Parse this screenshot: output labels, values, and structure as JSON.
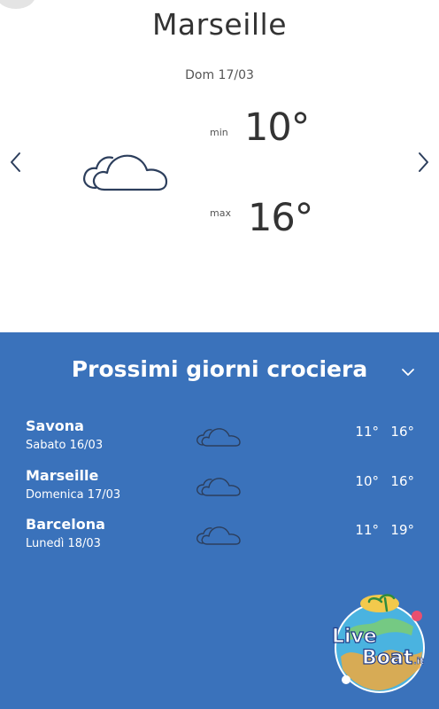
{
  "location": {
    "city": "Marseille",
    "date": "Dom 17/03"
  },
  "today": {
    "icon": "cloud-icon",
    "min_label": "min",
    "min_value": "10°",
    "max_label": "max",
    "max_value": "16°"
  },
  "nav": {
    "prev_icon": "chevron-left-icon",
    "next_icon": "chevron-right-icon"
  },
  "forecast": {
    "title": "Prossimi giorni crociera",
    "toggle_icon": "chevron-down-icon",
    "days": [
      {
        "port": "Savona",
        "day": "Sabato 16/03",
        "icon": "cloud-icon",
        "min": "11°",
        "max": "16°"
      },
      {
        "port": "Marseille",
        "day": "Domenica 17/03",
        "icon": "cloud-icon",
        "min": "10°",
        "max": "16°"
      },
      {
        "port": "Barcelona",
        "day": "Lunedì 18/03",
        "icon": "cloud-icon",
        "min": "11°",
        "max": "19°"
      }
    ]
  },
  "watermark": {
    "text": "LiveBoat.it"
  },
  "colors": {
    "panel_background": "#3a72bb",
    "icon_stroke": "#2c3e5c",
    "panel_text": "#ffffff"
  }
}
